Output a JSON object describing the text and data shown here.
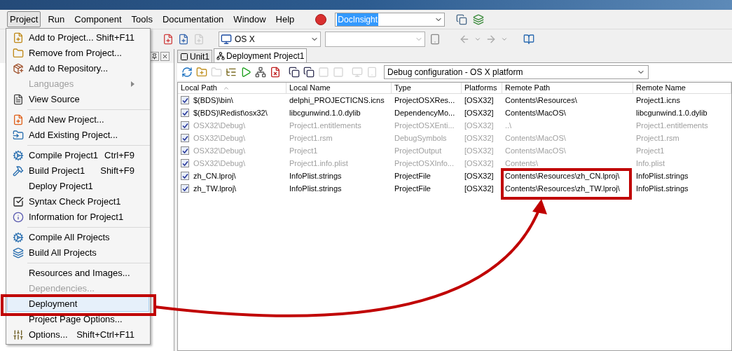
{
  "menubar": [
    {
      "label": "Project",
      "selected": true
    },
    {
      "label": "Run",
      "selected": false
    },
    {
      "label": "Component",
      "selected": false
    },
    {
      "label": "Tools",
      "selected": false
    },
    {
      "label": "Documentation",
      "selected": false
    },
    {
      "label": "Window",
      "selected": false
    },
    {
      "label": "Help",
      "selected": false
    }
  ],
  "help_combo": {
    "value": "DocInsight",
    "highlighted": true
  },
  "platform_combo": {
    "value": "OS X"
  },
  "tabs": [
    {
      "label": "Unit1",
      "selected": false
    },
    {
      "label": "Deployment Project1",
      "selected": true
    }
  ],
  "config_combo": {
    "value": "Debug configuration - OS X platform"
  },
  "table": {
    "columns": [
      "Local Path",
      "Local Name",
      "Type",
      "Platforms",
      "Remote Path",
      "Remote Name"
    ],
    "rows": [
      {
        "checked": true,
        "disabled": false,
        "cells": [
          "$(BDS)\\bin\\",
          "delphi_PROJECTICNS.icns",
          "ProjectOSXRes...",
          "[OSX32]",
          "Contents\\Resources\\",
          "Project1.icns"
        ]
      },
      {
        "checked": true,
        "disabled": false,
        "cells": [
          "$(BDS)\\Redist\\osx32\\",
          "libcgunwind.1.0.dylib",
          "DependencyMo...",
          "[OSX32]",
          "Contents\\MacOS\\",
          "libcgunwind.1.0.dylib"
        ]
      },
      {
        "checked": true,
        "disabled": true,
        "cells": [
          "OSX32\\Debug\\",
          "Project1.entitlements",
          "ProjectOSXEnti...",
          "[OSX32]",
          "..\\",
          "Project1.entitlements"
        ]
      },
      {
        "checked": true,
        "disabled": true,
        "cells": [
          "OSX32\\Debug\\",
          "Project1.rsm",
          "DebugSymbols",
          "[OSX32]",
          "Contents\\MacOS\\",
          "Project1.rsm"
        ]
      },
      {
        "checked": true,
        "disabled": true,
        "cells": [
          "OSX32\\Debug\\",
          "Project1",
          "ProjectOutput",
          "[OSX32]",
          "Contents\\MacOS\\",
          "Project1"
        ]
      },
      {
        "checked": true,
        "disabled": true,
        "cells": [
          "OSX32\\Debug\\",
          "Project1.info.plist",
          "ProjectOSXInfo...",
          "[OSX32]",
          "Contents\\",
          "Info.plist"
        ]
      },
      {
        "checked": true,
        "disabled": false,
        "cells": [
          "zh_CN.lproj\\",
          "InfoPlist.strings",
          "ProjectFile",
          "[OSX32]",
          "Contents\\Resources\\zh_CN.lproj\\",
          "InfoPlist.strings"
        ]
      },
      {
        "checked": true,
        "disabled": false,
        "cells": [
          "zh_TW.lproj\\",
          "InfoPlist.strings",
          "ProjectFile",
          "[OSX32]",
          "Contents\\Resources\\zh_TW.lproj\\",
          "InfoPlist.strings"
        ]
      }
    ]
  },
  "menu": [
    {
      "kind": "item",
      "label": "Add to Project...",
      "shortcut": "Shift+F11",
      "disabled": false,
      "selected": false
    },
    {
      "kind": "item",
      "label": "Remove from Project...",
      "disabled": false,
      "selected": false
    },
    {
      "kind": "item",
      "label": "Add to Repository...",
      "disabled": false,
      "selected": false
    },
    {
      "kind": "submenu",
      "label": "Languages",
      "disabled": true,
      "selected": false
    },
    {
      "kind": "item",
      "label": "View Source",
      "disabled": false,
      "selected": false
    },
    {
      "kind": "separator"
    },
    {
      "kind": "item",
      "label": "Add New Project...",
      "disabled": false,
      "selected": false
    },
    {
      "kind": "item",
      "label": "Add Existing Project...",
      "disabled": false,
      "selected": false
    },
    {
      "kind": "separator"
    },
    {
      "kind": "item",
      "label": "Compile Project1",
      "shortcut": "Ctrl+F9",
      "disabled": false,
      "selected": false
    },
    {
      "kind": "item",
      "label": "Build Project1",
      "shortcut": "Shift+F9",
      "disabled": false,
      "selected": false
    },
    {
      "kind": "item",
      "label": "Deploy Project1",
      "disabled": false,
      "selected": false
    },
    {
      "kind": "item",
      "label": "Syntax Check Project1",
      "disabled": false,
      "selected": false
    },
    {
      "kind": "item",
      "label": "Information for Project1",
      "disabled": false,
      "selected": false
    },
    {
      "kind": "separator"
    },
    {
      "kind": "item",
      "label": "Compile All Projects",
      "disabled": false,
      "selected": false
    },
    {
      "kind": "item",
      "label": "Build All Projects",
      "disabled": false,
      "selected": false
    },
    {
      "kind": "separator"
    },
    {
      "kind": "item",
      "label": "Resources and Images...",
      "disabled": false,
      "selected": false
    },
    {
      "kind": "item",
      "label": "Dependencies...",
      "disabled": true,
      "selected": false
    },
    {
      "kind": "item",
      "label": "Deployment",
      "disabled": false,
      "selected": true
    },
    {
      "kind": "item",
      "label": "Project Page Options...",
      "disabled": false,
      "selected": false
    },
    {
      "kind": "item",
      "label": "Options...",
      "shortcut": "Shift+Ctrl+F11",
      "disabled": false,
      "selected": false
    }
  ]
}
